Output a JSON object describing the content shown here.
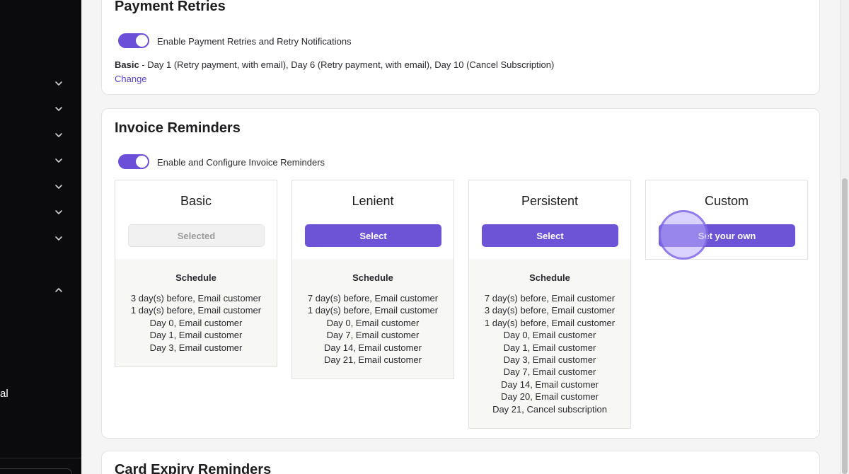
{
  "sidebar": {
    "partial_text": "al",
    "icons": [
      "chevron-down-icon",
      "chevron-down-icon",
      "chevron-down-icon",
      "chevron-down-icon",
      "chevron-down-icon",
      "chevron-down-icon",
      "chevron-down-icon",
      "chevron-up-icon"
    ]
  },
  "payment_retries": {
    "title": "Payment Retries",
    "toggle_on": true,
    "toggle_label": "Enable Payment Retries and Retry Notifications",
    "plan_name": "Basic",
    "plan_desc": " - Day 1 (Retry payment, with email), Day 6 (Retry payment, with email), Day 10 (Cancel Subscription)",
    "change_label": "Change"
  },
  "invoice_reminders": {
    "title": "Invoice Reminders",
    "toggle_on": true,
    "toggle_label": "Enable and Configure Invoice Reminders",
    "schedule_heading": "Schedule",
    "plans": [
      {
        "name": "Basic",
        "button": "Selected",
        "selected": true,
        "schedule": [
          "3 day(s) before, Email customer",
          "1 day(s) before, Email customer",
          "Day 0, Email customer",
          "Day 1, Email customer",
          "Day 3, Email customer"
        ]
      },
      {
        "name": "Lenient",
        "button": "Select",
        "selected": false,
        "schedule": [
          "7 day(s) before, Email customer",
          "1 day(s) before, Email customer",
          "Day 0, Email customer",
          "Day 7, Email customer",
          "Day 14, Email customer",
          "Day 21, Email customer"
        ]
      },
      {
        "name": "Persistent",
        "button": "Select",
        "selected": false,
        "schedule": [
          "7 day(s) before, Email customer",
          "3 day(s) before, Email customer",
          "1 day(s) before, Email customer",
          "Day 0, Email customer",
          "Day 1, Email customer",
          "Day 3, Email customer",
          "Day 7, Email customer",
          "Day 14, Email customer",
          "Day 20, Email customer",
          "Day 21, Cancel subscription"
        ]
      },
      {
        "name": "Custom",
        "button": "Set your own",
        "selected": false,
        "schedule": []
      }
    ]
  },
  "card_expiry": {
    "title": "Card Expiry Reminders"
  },
  "colors": {
    "accent": "#6d54d6",
    "toggle": "#6b4fd8",
    "sidebar_bg": "#0b0b0e",
    "link": "#5b47c9"
  }
}
